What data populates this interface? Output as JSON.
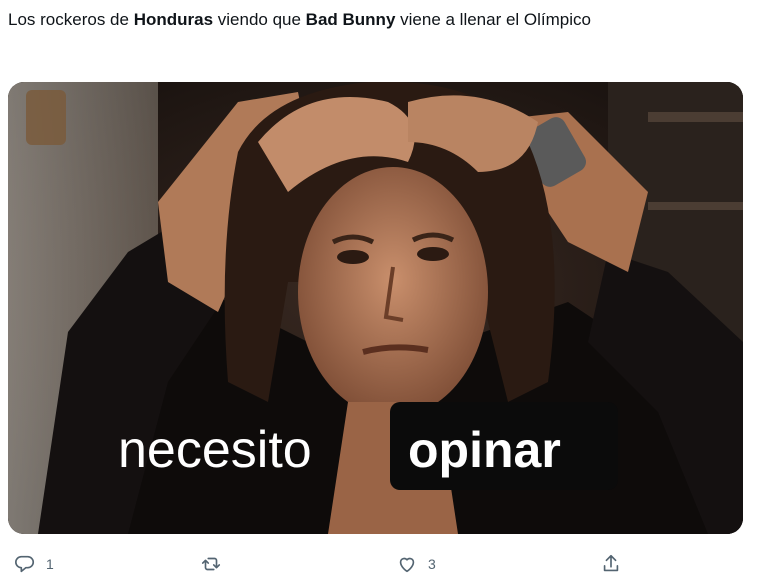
{
  "tweet": {
    "text_pre": "Los rockeros de ",
    "text_bold1": "Honduras",
    "text_mid": " viendo que ",
    "text_bold2": "Bad Bunny",
    "text_post": " viene a  llenar el Olímpico"
  },
  "media": {
    "caption_plain": "necesito",
    "caption_highlight": "opinar"
  },
  "actions": {
    "reply_count": "1",
    "retweet_count": "",
    "like_count": "3"
  },
  "icons": {
    "reply": "reply-icon",
    "retweet": "retweet-icon",
    "like": "heart-icon",
    "share": "share-icon"
  },
  "colors": {
    "icon_gray": "#536471",
    "text": "#0f1419"
  }
}
